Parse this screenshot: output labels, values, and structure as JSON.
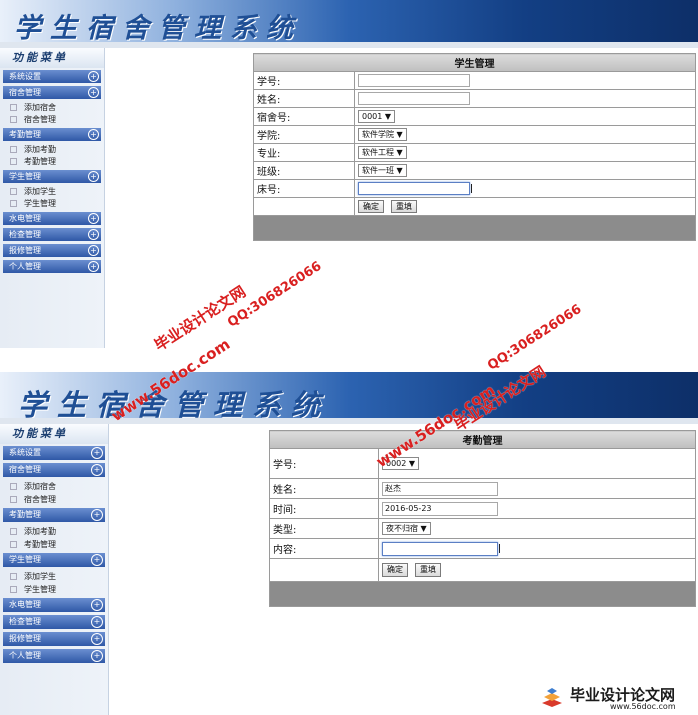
{
  "app_title": "学生宿舍管理系统",
  "menu": {
    "title": "功能菜单",
    "sections": [
      {
        "label": "系统设置",
        "items": []
      },
      {
        "label": "宿舍管理",
        "items": [
          "添加宿舍",
          "宿舍管理"
        ]
      },
      {
        "label": "考勤管理",
        "items": [
          "添加考勤",
          "考勤管理"
        ]
      },
      {
        "label": "学生管理",
        "items": [
          "添加学生",
          "学生管理"
        ]
      },
      {
        "label": "水电管理",
        "items": []
      },
      {
        "label": "检查管理",
        "items": []
      },
      {
        "label": "报修管理",
        "items": []
      },
      {
        "label": "个人管理",
        "items": []
      }
    ]
  },
  "student_form": {
    "header": "学生管理",
    "labels": {
      "student_no": "学号:",
      "name": "姓名:",
      "dorm_no": "宿舍号:",
      "college": "学院:",
      "major": "专业:",
      "class": "班级:",
      "bed_no": "床号:"
    },
    "values": {
      "student_no": "",
      "name": "",
      "dorm_no": "0001",
      "college": "软件学院",
      "major": "软件工程",
      "class": "软件一班",
      "bed_no": ""
    },
    "buttons": {
      "confirm": "确定",
      "reset": "重填"
    }
  },
  "attendance_form": {
    "header": "考勤管理",
    "labels": {
      "student_no": "学号:",
      "name": "姓名:",
      "time": "时间:",
      "type": "类型:",
      "content": "内容:"
    },
    "values": {
      "student_no": "0002",
      "name": "赵杰",
      "time": "2016-05-23",
      "type": "夜不归宿",
      "content": ""
    },
    "buttons": {
      "confirm": "确定",
      "reset": "重填"
    }
  },
  "watermarks": {
    "site_cn": "毕业设计论文网",
    "qq": "QQ:306826066",
    "url": "www.56doc.com"
  },
  "brand": {
    "name": "毕业设计论文网",
    "url": "www.56doc.com"
  },
  "colors": {
    "accent": "#2f58a6",
    "banner_dark": "#0d2f68",
    "watermark": "#d92020"
  }
}
